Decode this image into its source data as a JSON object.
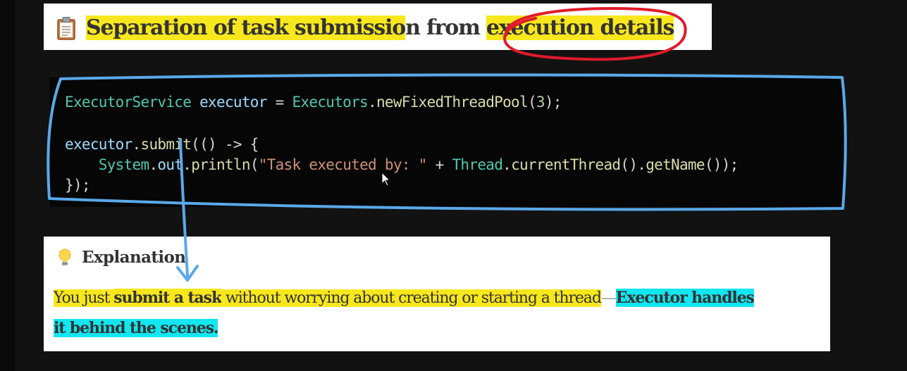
{
  "title": {
    "icon": "clipboard-icon",
    "part1": "Separation of task submissio",
    "part2": "n from ",
    "part3": "execution detai",
    "part4": "ls"
  },
  "code": {
    "line1": {
      "type": "ExecutorService",
      "var": "executor",
      "eq": " = ",
      "cls": "Executors",
      "dot": ".",
      "method": "newFixedThreadPool",
      "open": "(",
      "num": "3",
      "close": ");"
    },
    "line2": {
      "var": "executor",
      "dot": ".",
      "method": "submit",
      "rest": "(() -> {"
    },
    "line3": {
      "indent": "    ",
      "cls": "System",
      "dot1": ".",
      "field": "out",
      "dot2": ".",
      "method": "println",
      "open": "(",
      "str": "\"Task executed by: \"",
      "plus": " + ",
      "cls2": "Thread",
      "dot3": ".",
      "method2": "currentThread",
      "mid": "().",
      "method3": "getName",
      "close": "());"
    },
    "line4": "});"
  },
  "explanation": {
    "icon": "lightbulb-icon",
    "title": "Explanation",
    "seg1": "You just ",
    "seg2": "submit a task",
    "seg3": " without worrying about creating or starting a thread",
    "dash": "—",
    "seg4": "Executor handles",
    "seg5": "it behind the scenes."
  },
  "colors": {
    "highlight_yellow": "#f8e71c",
    "highlight_cyan": "#12e6f0",
    "annotation_red": "#e01b2a",
    "annotation_blue": "#5aa9ea"
  }
}
